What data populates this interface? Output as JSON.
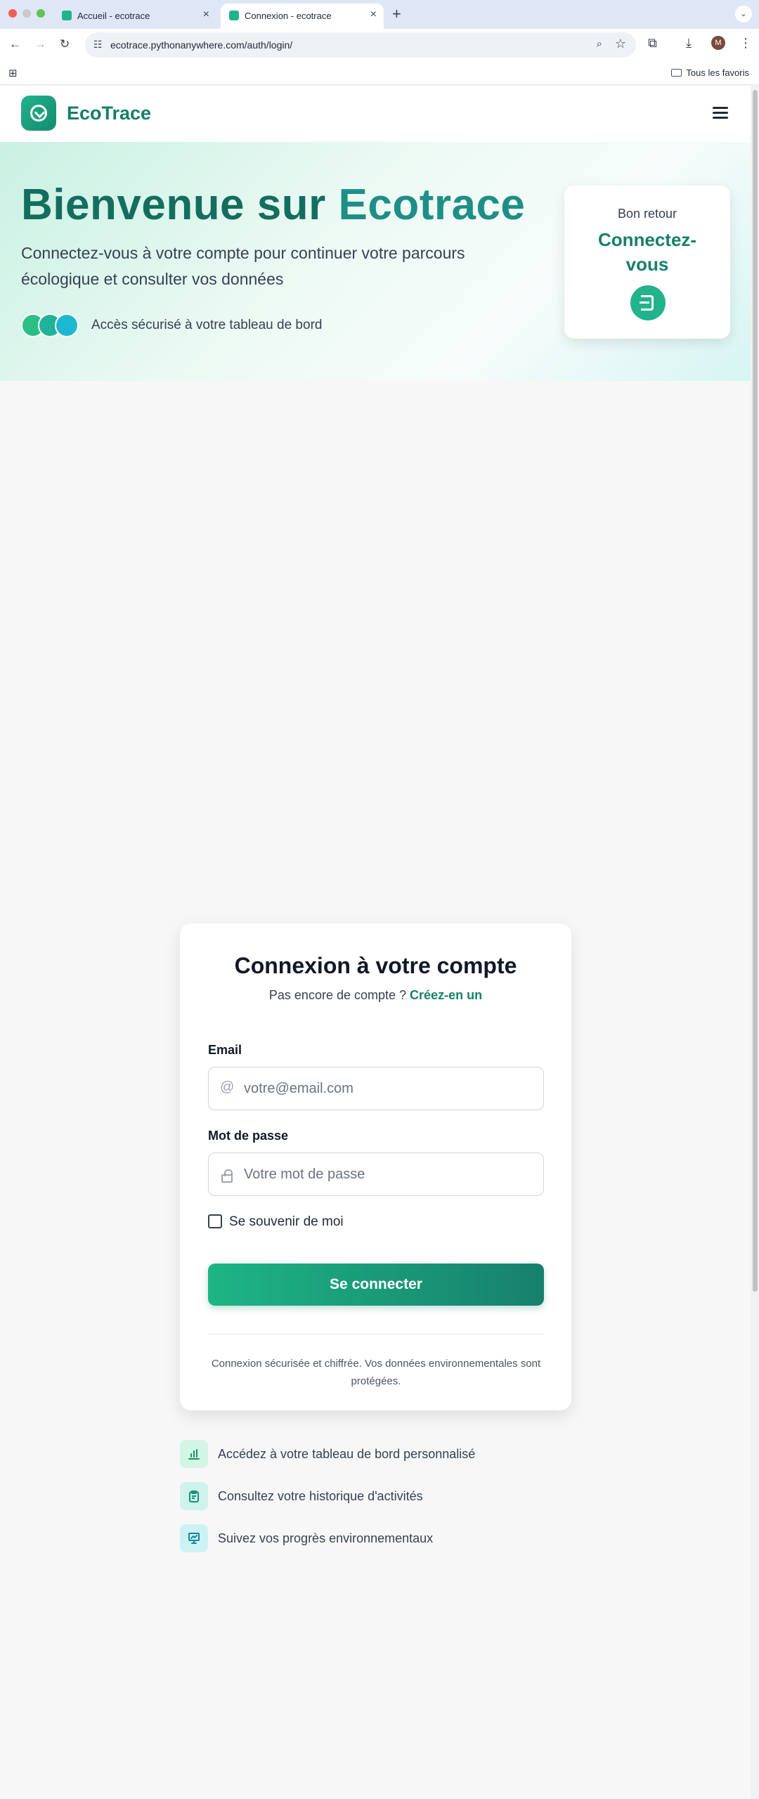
{
  "browser": {
    "tabs": [
      {
        "title": "Accueil - ecotrace",
        "close": "×"
      },
      {
        "title": "Connexion - ecotrace",
        "close": "×"
      }
    ],
    "new_tab": "+",
    "tab_menu": "⌄",
    "back": "←",
    "forward": "→",
    "reload": "↻",
    "url": "ecotrace.pythonanywhere.com/auth/login/",
    "profile_initial": "M",
    "bookmarks_folder": "Tous les favoris"
  },
  "header": {
    "brand": "EcoTrace"
  },
  "hero": {
    "title_part1": "Bienvenue sur ",
    "title_part2": "Ecotrace",
    "subtitle": "Connectez-vous à votre compte pour continuer votre parcours écologique et consulter vos données",
    "note": "Accès sécurisé à votre tableau de bord",
    "avatar_colors": [
      "#2bbf86",
      "#20b39a",
      "#1cb8d2"
    ],
    "card_small": "Bon retour",
    "card_big": "Connectez-vous"
  },
  "login": {
    "title": "Connexion à votre compte",
    "prompt": "Pas encore de compte ?",
    "signup_link": "Créez-en un",
    "email_label": "Email",
    "email_placeholder": "votre@email.com",
    "email_value": "",
    "password_label": "Mot de passe",
    "password_placeholder": "Votre mot de passe",
    "password_value": "",
    "remember_label": "Se souvenir de moi",
    "remember_checked": false,
    "submit_label": "Se connecter",
    "secure_note": "Connexion sécurisée et chiffrée. Vos données environnementales sont protégées."
  },
  "features": [
    {
      "text": "Accédez à votre tableau de bord personnalisé",
      "icon": "bar-chart-icon",
      "bg": "#d3f5e4",
      "fg": "#1a8f6a"
    },
    {
      "text": "Consultez votre historique d'activités",
      "icon": "clipboard-icon",
      "bg": "#cdf3ea",
      "fg": "#1a8f7a"
    },
    {
      "text": "Suivez vos progrès environnementaux",
      "icon": "presentation-icon",
      "bg": "#cdf2f5",
      "fg": "#168796"
    }
  ],
  "colors": {
    "brand": "#147e68",
    "accent": "#22b38c",
    "page_bg": "#f7f7f8"
  }
}
